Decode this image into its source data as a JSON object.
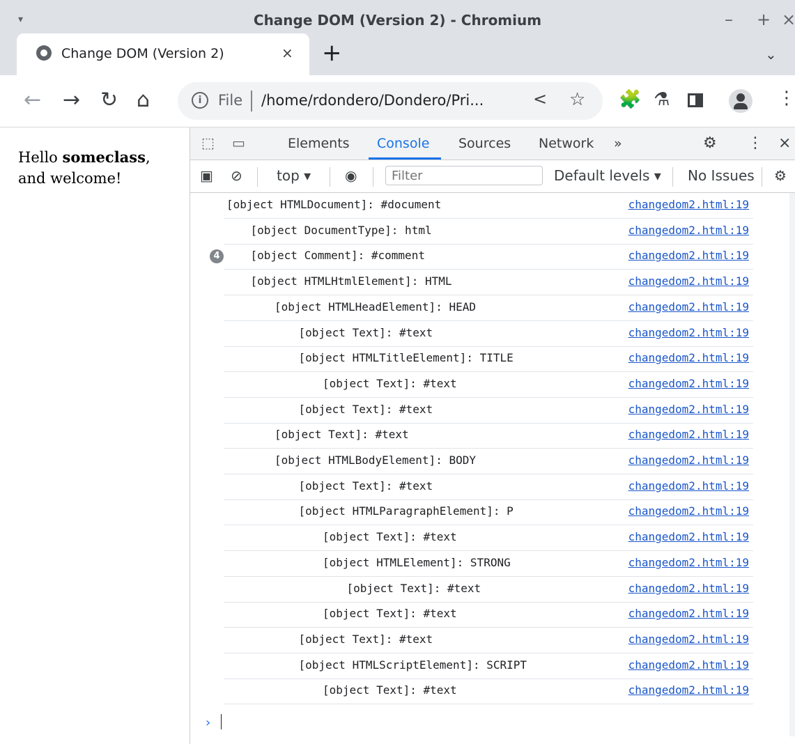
{
  "window": {
    "title": "Change DOM (Version 2) - Chromium",
    "menu_icon": "▾",
    "minimize": "–",
    "maximize": "+",
    "close": "×"
  },
  "tab": {
    "title": "Change DOM (Version 2)",
    "close": "×",
    "new_tab": "+",
    "menu": "⌄"
  },
  "toolbar": {
    "back": "←",
    "forward": "→",
    "reload": "↻",
    "home": "⌂",
    "info": "i",
    "file_label": "File",
    "url": "/home/rdondero/Dondero/Pri...",
    "share": "<",
    "bookmark": "☆",
    "extensions": "🧩",
    "labs": "⚗",
    "more": "⋮"
  },
  "page": {
    "text_before": "Hello ",
    "strong": "someclass",
    "text_after": ",",
    "line2": "and welcome!"
  },
  "devtools": {
    "inspect": "⬚",
    "device": "▭",
    "tabs": [
      "Elements",
      "Console",
      "Sources",
      "Network"
    ],
    "overflow": "»",
    "settings": "⚙",
    "more": "⋮",
    "close": "×",
    "sidebar_toggle": "▣",
    "clear": "⊘",
    "context": "top ▾",
    "eye": "◉",
    "filter_placeholder": "Filter",
    "levels": "Default levels ▾",
    "issues": "No Issues",
    "settings2": "⚙",
    "prompt": "›"
  },
  "console_rows": [
    {
      "text": "[object HTMLDocument]: #document",
      "source": "changedom2.html:19",
      "indent": 0
    },
    {
      "text": "[object DocumentType]: html",
      "source": "changedom2.html:19",
      "indent": 1
    },
    {
      "text": "[object Comment]: #comment",
      "source": "changedom2.html:19",
      "indent": 1,
      "badge": "4"
    },
    {
      "text": "[object HTMLHtmlElement]: HTML",
      "source": "changedom2.html:19",
      "indent": 1
    },
    {
      "text": "[object HTMLHeadElement]: HEAD",
      "source": "changedom2.html:19",
      "indent": 2
    },
    {
      "text": "[object Text]: #text",
      "source": "changedom2.html:19",
      "indent": 3
    },
    {
      "text": "[object HTMLTitleElement]: TITLE",
      "source": "changedom2.html:19",
      "indent": 3
    },
    {
      "text": "[object Text]: #text",
      "source": "changedom2.html:19",
      "indent": 4
    },
    {
      "text": "[object Text]: #text",
      "source": "changedom2.html:19",
      "indent": 3
    },
    {
      "text": "[object Text]: #text",
      "source": "changedom2.html:19",
      "indent": 2
    },
    {
      "text": "[object HTMLBodyElement]: BODY",
      "source": "changedom2.html:19",
      "indent": 2
    },
    {
      "text": "[object Text]: #text",
      "source": "changedom2.html:19",
      "indent": 3
    },
    {
      "text": "[object HTMLParagraphElement]: P",
      "source": "changedom2.html:19",
      "indent": 3
    },
    {
      "text": "[object Text]: #text",
      "source": "changedom2.html:19",
      "indent": 4
    },
    {
      "text": "[object HTMLElement]: STRONG",
      "source": "changedom2.html:19",
      "indent": 4
    },
    {
      "text": "[object Text]: #text",
      "source": "changedom2.html:19",
      "indent": 5
    },
    {
      "text": "[object Text]: #text",
      "source": "changedom2.html:19",
      "indent": 4
    },
    {
      "text": "[object Text]: #text",
      "source": "changedom2.html:19",
      "indent": 3
    },
    {
      "text": "[object HTMLScriptElement]: SCRIPT",
      "source": "changedom2.html:19",
      "indent": 3
    },
    {
      "text": "[object Text]: #text",
      "source": "changedom2.html:19",
      "indent": 4
    }
  ]
}
